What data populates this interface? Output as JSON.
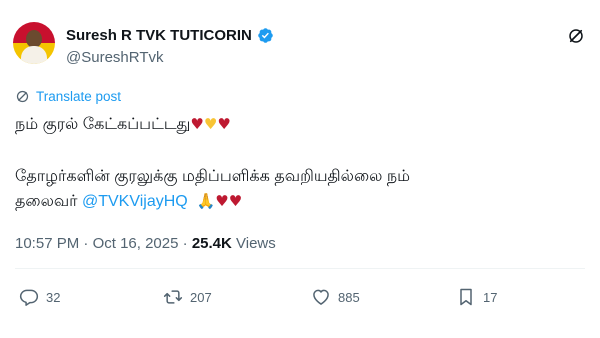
{
  "author": {
    "display_name": "Suresh R TVK TUTICORIN",
    "handle": "@SureshRTvk"
  },
  "translate_label": "Translate post",
  "tweet": {
    "line1": "நம் குரல் கேட்கப்பட்டது",
    "line1_emoji": [
      "♥",
      "♥",
      "♥"
    ],
    "line2": "தோழர்களின் குரலுக்கு மதிப்பளிக்க தவறியதில்லை நம்",
    "line3_prefix": "தலைவர் ",
    "mention": "@TVKVijayHQ",
    "line3_emoji": [
      "🙏",
      "♥",
      "♥"
    ]
  },
  "meta": {
    "time": "10:57 PM",
    "separator": "·",
    "date": "Oct 16, 2025",
    "views_count": "25.4K",
    "views_label": "Views"
  },
  "actions": {
    "replies": "32",
    "reposts": "207",
    "likes": "885",
    "bookmarks": "17"
  },
  "colors": {
    "accent": "#1d9bf0",
    "text": "#0f1419",
    "muted": "#536471",
    "heart_red": "#be1931",
    "heart_yellow": "#f8c435"
  },
  "icons": [
    "verified-badge-icon",
    "grok-icon",
    "translate-icon",
    "reply-icon",
    "repost-icon",
    "like-icon",
    "bookmark-icon"
  ]
}
